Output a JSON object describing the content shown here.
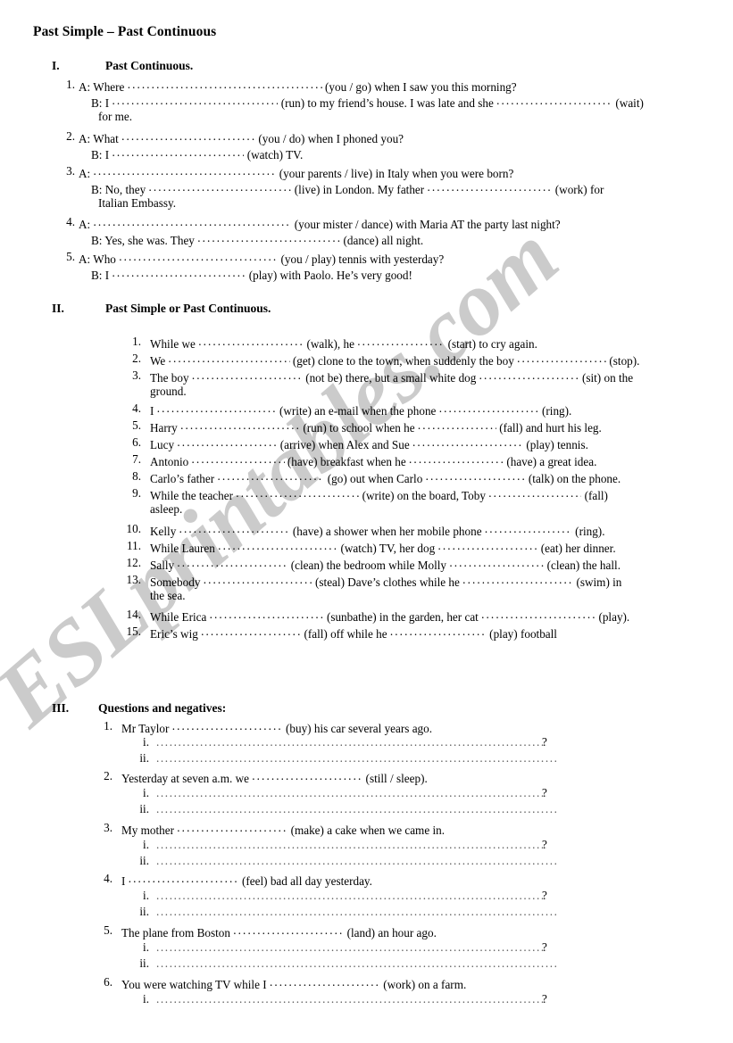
{
  "document": {
    "title": "Past Simple – Past Continuous",
    "watermark": "ESLprintables.com",
    "watermark_color": "#cbcbcb"
  },
  "sections": [
    {
      "number": "I.",
      "heading": "Past Continuous.",
      "items": [
        {
          "index": "1.",
          "lines": [
            {
              "speaker": "A:",
              "before": "Where",
              "blank": 1,
              "after": "(you / go) when I saw you this morning?"
            },
            {
              "speaker": "B:",
              "before": "I",
              "blank": 1,
              "after": "(run) to my friend’s house. I was late and she",
              "blank2": 1,
              "after2": "(wait)"
            },
            {
              "speaker": "",
              "before": "for me.",
              "blank": 0,
              "after": ""
            }
          ]
        },
        {
          "index": "2.",
          "lines": [
            {
              "speaker": "A:",
              "before": "What",
              "blank": 1,
              "after": "(you / do) when I phoned you?"
            },
            {
              "speaker": "B:",
              "before": "I",
              "blank": 1,
              "after": "(watch) TV."
            }
          ]
        },
        {
          "index": "3.",
          "lines": [
            {
              "speaker": "A:",
              "before": "",
              "blank": 1,
              "after": "(your parents / live) in Italy when you were born?"
            },
            {
              "speaker": "B:",
              "before": "No, they",
              "blank": 1,
              "after": "(live) in London. My father",
              "blank2": 1,
              "after2": "(work) for"
            },
            {
              "speaker": "",
              "before": "Italian Embassy.",
              "blank": 0,
              "after": ""
            }
          ]
        },
        {
          "index": "4.",
          "lines": [
            {
              "speaker": "A:",
              "before": "",
              "blank": 1,
              "after": "(your mister / dance) with Maria AT the party last night?"
            },
            {
              "speaker": "B:",
              "before": "Yes, she was.  They",
              "blank": 1,
              "after": "(dance) all night."
            }
          ]
        },
        {
          "index": "5.",
          "lines": [
            {
              "speaker": "A:",
              "before": "Who",
              "blank": 1,
              "after": "(you / play) tennis with yesterday?"
            },
            {
              "speaker": "B:",
              "before": "I",
              "blank": 1,
              "after": "(play) with Paolo. He’s very good!"
            }
          ]
        }
      ]
    },
    {
      "number": "II.",
      "heading": "Past Simple or Past Continuous.",
      "items": [
        {
          "index": "1.",
          "text_a": "While we",
          "text_b": "(walk), he",
          "text_c": "(start) to cry again."
        },
        {
          "index": "2.",
          "text_a": "We",
          "text_b": "(get) clone to the town, when suddenly the boy",
          "text_c": "(stop)."
        },
        {
          "index": "3.",
          "text_a": "The boy",
          "text_b": "(not be) there, but a small white dog",
          "text_c": "(sit) on the",
          "wrap": "ground."
        },
        {
          "index": "4.",
          "text_a": "I",
          "text_b": "(write) an e-mail when the phone",
          "text_c": "(ring)."
        },
        {
          "index": "5.",
          "text_a": "Harry",
          "text_b": "(run) to school when he",
          "text_c": "(fall) and hurt his leg."
        },
        {
          "index": "6.",
          "text_a": "Lucy",
          "text_b": "(arrive) when Alex and Sue",
          "text_c": "(play) tennis."
        },
        {
          "index": "7.",
          "text_a": "Antonio",
          "text_b": "(have) breakfast when he",
          "text_c": "(have) a great idea."
        },
        {
          "index": "8.",
          "text_a": "Carlo’s father",
          "text_b": "(go) out when Carlo",
          "text_c": "(talk) on the phone."
        },
        {
          "index": "9.",
          "text_a": "While the teacher",
          "text_b": "(write) on the board, Toby",
          "text_c": "(fall)",
          "wrap": "asleep."
        },
        {
          "index": "10.",
          "text_a": "Kelly",
          "text_b": "(have) a shower when her mobile phone",
          "text_c": "(ring)."
        },
        {
          "index": "11.",
          "text_a": "While Lauren",
          "text_b": "(watch) TV, her dog",
          "text_c": "(eat) her dinner."
        },
        {
          "index": "12.",
          "text_a": "Sally",
          "text_b": "(clean) the bedroom while Molly",
          "text_c": "(clean) the hall."
        },
        {
          "index": "13.",
          "text_a": "Somebody",
          "text_b": "(steal) Dave’s clothes while he",
          "text_c": "(swim) in",
          "wrap": "the sea."
        },
        {
          "index": "14.",
          "text_a": "While Erica",
          "text_b": "(sunbathe) in the garden, her cat",
          "text_c": "(play)."
        },
        {
          "index": "15.",
          "text_a": "Eric’s  wig",
          "text_b": "(fall) off while he",
          "text_c": "(play) football"
        }
      ]
    },
    {
      "number": "III.",
      "heading": "Questions and negatives:",
      "items": [
        {
          "index": "1.",
          "text_a": "Mr Taylor",
          "text_b": "(buy) his car several years ago.",
          "answers": [
            "i.",
            "ii."
          ]
        },
        {
          "index": "2.",
          "text_a": "Yesterday at seven a.m.  we",
          "text_b": "(still / sleep).",
          "answers": [
            "i.",
            "ii."
          ]
        },
        {
          "index": "3.",
          "text_a": "My mother",
          "text_b": "(make) a cake when we came in.",
          "answers": [
            "i.",
            "ii."
          ]
        },
        {
          "index": "4.",
          "text_a": "I",
          "text_b": "(feel) bad all day yesterday.",
          "answers": [
            "i.",
            "ii."
          ]
        },
        {
          "index": "5.",
          "text_a": "The plane from Boston",
          "text_b": "(land) an hour ago.",
          "answers": [
            "i.",
            "ii."
          ]
        },
        {
          "index": "6.",
          "text_a": "You were watching TV while I",
          "text_b": "(work) on a farm.",
          "answers": [
            "i."
          ]
        }
      ]
    }
  ],
  "question_mark": "?"
}
